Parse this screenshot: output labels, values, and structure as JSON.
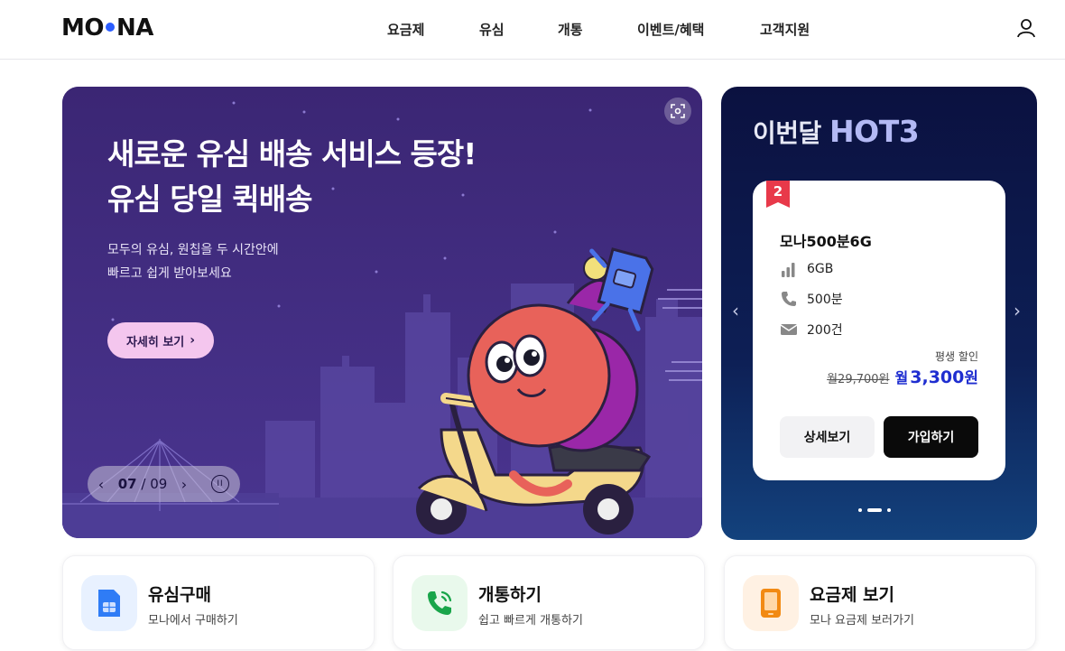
{
  "header": {
    "logo": "MO NA",
    "logo_left": "MO",
    "logo_right": "NA",
    "nav": [
      "요금제",
      "유심",
      "개통",
      "이벤트/혜택",
      "고객지원"
    ],
    "user_icon": "user-icon"
  },
  "hero": {
    "title_line1": "새로운 유심 배송 서비스 등장!",
    "title_line2": "유심 당일 퀵배송",
    "sub_line1": "모두의 유심, 원칩을 두 시간안에",
    "sub_line2": "빠르고 쉽게 받아보세요",
    "cta_label": "자세히 보기",
    "page_current": "07",
    "page_separator": "/",
    "page_total": "09",
    "colors": {
      "background": "#3a2775",
      "cta": "#f4c6ee"
    }
  },
  "hot": {
    "title_prefix": "이번달",
    "title_highlight": "HOT3",
    "card": {
      "rank": "2",
      "plan_name": "모나500분6G",
      "data": "6GB",
      "voice": "500분",
      "sms": "200건",
      "discount_label": "평생 할인",
      "old_price": "월29,700원",
      "new_price_prefix": "월",
      "new_price": "3,300",
      "new_price_unit": "원",
      "detail_label": "상세보기",
      "join_label": "가입하기"
    },
    "active_slide": 2,
    "slide_count": 3,
    "colors": {
      "accent": "#1f2ed0",
      "rank": "#e8394a"
    }
  },
  "quick": [
    {
      "title": "유심구매",
      "sub": "모나에서 구매하기",
      "icon": "sim-card-icon"
    },
    {
      "title": "개통하기",
      "sub": "쉽고 빠르게 개통하기",
      "icon": "phone-call-icon"
    },
    {
      "title": "요금제 보기",
      "sub": "모나 요금제 보러가기",
      "icon": "mobile-phone-icon"
    }
  ]
}
